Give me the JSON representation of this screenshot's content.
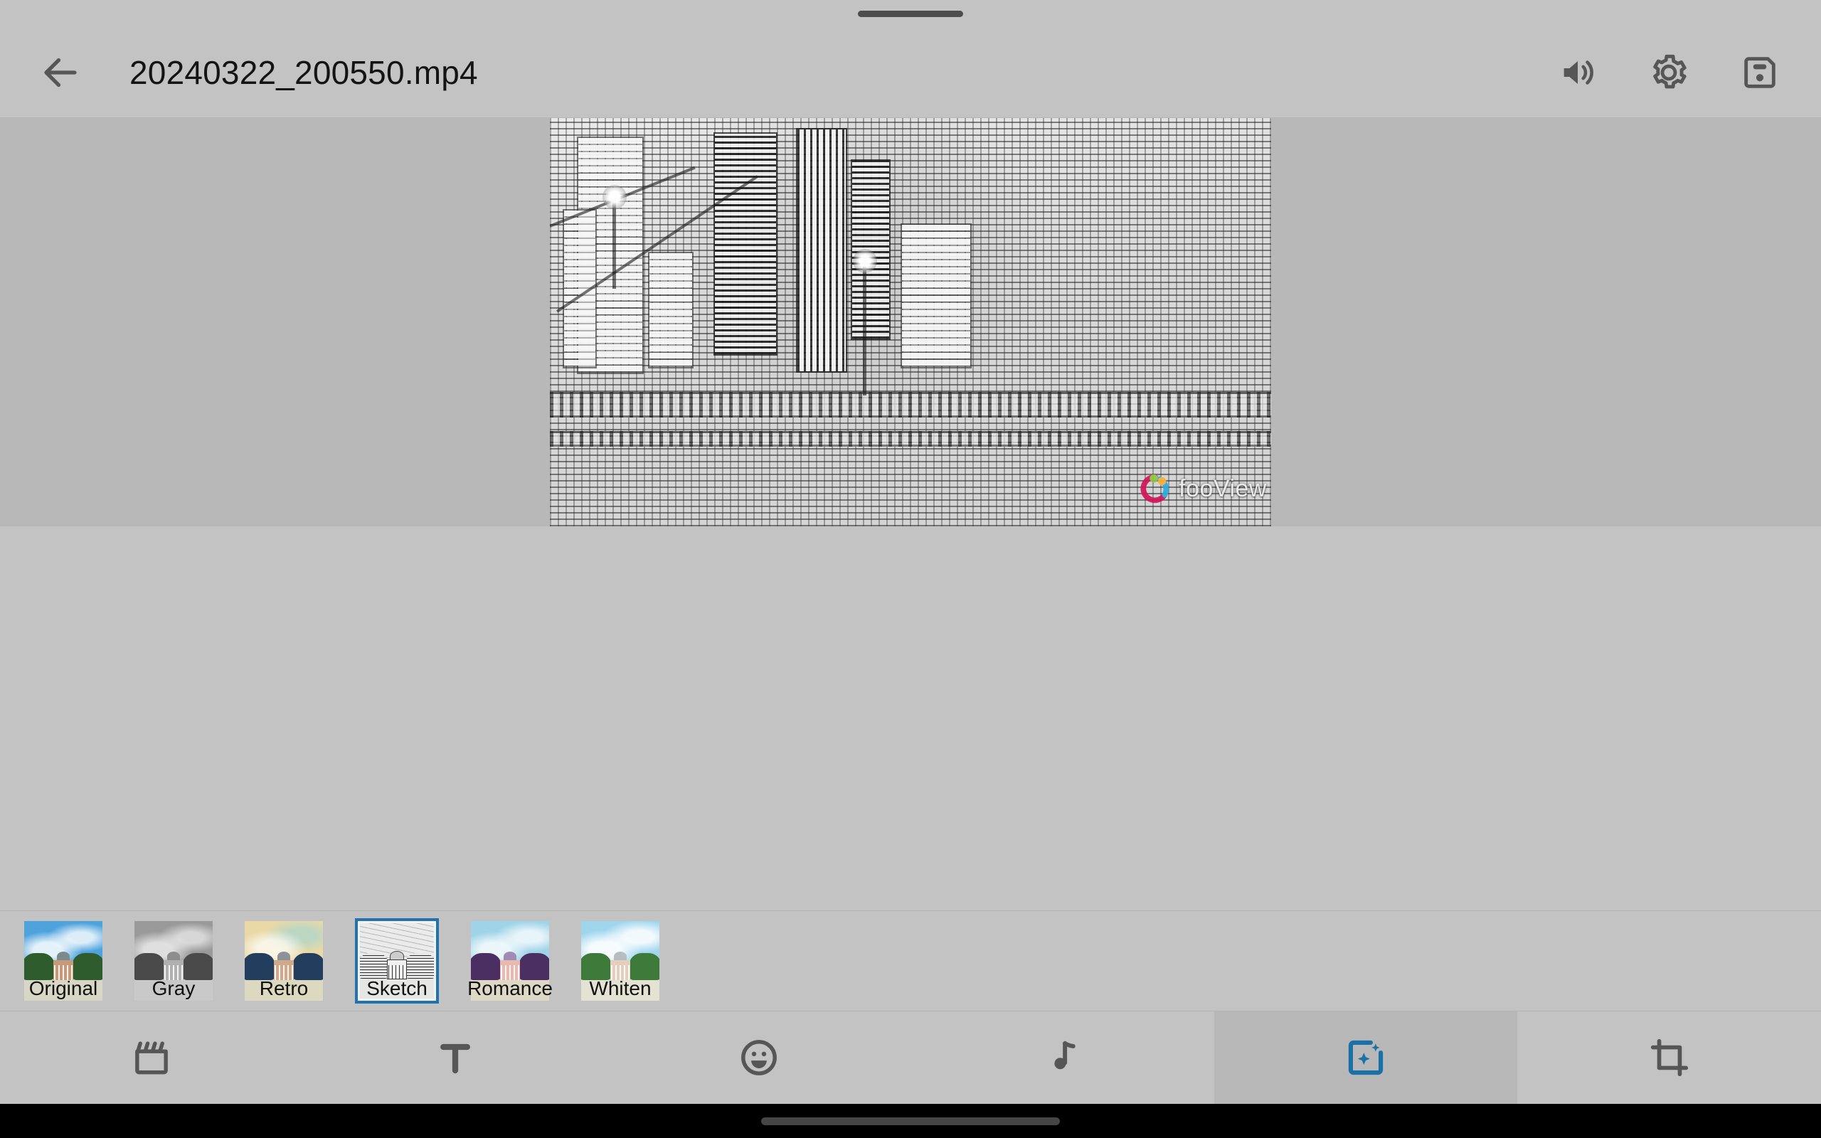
{
  "window": {
    "drag_handle": "drag-handle",
    "background_color": "#c3c3c3"
  },
  "header": {
    "back_icon": "arrow-left-icon",
    "title": "20240322_200550.mp4",
    "actions": [
      {
        "name": "volume-button",
        "icon": "volume-up-icon",
        "label": "Volume"
      },
      {
        "name": "settings-button",
        "icon": "gear-icon",
        "label": "Settings"
      },
      {
        "name": "save-button",
        "icon": "floppy-disk-save-icon",
        "label": "Save"
      }
    ]
  },
  "preview": {
    "name": "video-preview",
    "applied_filter": "Sketch",
    "watermark_text": "fooView",
    "watermark_logo": "fooview-logo-icon",
    "canvas_color": "#b8b8b8"
  },
  "side_handle": {
    "name": "edge-pill-handle"
  },
  "filters": {
    "selected": "Sketch",
    "selected_border_color": "#2172ae",
    "items": [
      {
        "label": "Original",
        "sky": "#4ea3dd",
        "ground": "#d8d6c4",
        "tree": "#2f5c2c",
        "bldg_body": "#c49a7b",
        "dome": "#7d8a8c"
      },
      {
        "label": "Gray",
        "sky": "#9a9a9a",
        "ground": "#c9c9c9",
        "tree": "#4a4a4a",
        "bldg_body": "#b0b0b0",
        "dome": "#8d8d8d"
      },
      {
        "label": "Retro",
        "sky": "#ead9a6",
        "ground": "#dcd9c0",
        "tree": "#223d5e",
        "bldg_body": "#cfa98c",
        "dome": "#8d9298"
      },
      {
        "label": "Sketch",
        "sky": "#ebebeb",
        "ground": "#e6e6e4",
        "tree": "#3a3a3a",
        "bldg_body": "#f0f0f0",
        "dome": "#cccccc"
      },
      {
        "label": "Romance",
        "sky": "#9fd4e8",
        "ground": "#ded8c6",
        "tree": "#4b2f63",
        "bldg_body": "#e8b9b0",
        "dome": "#a08bb5"
      },
      {
        "label": "Whiten",
        "sky": "#9fd6ee",
        "ground": "#e4e2d2",
        "tree": "#3e7a3a",
        "bldg_body": "#e3cfc0",
        "dome": "#b7bec0"
      }
    ]
  },
  "toolbar": {
    "active": "Filters",
    "active_color": "#1971a8",
    "tabs": [
      {
        "label": "Clip",
        "icon": "clapperboard-icon",
        "active": false
      },
      {
        "label": "Text",
        "icon": "text-t-icon",
        "active": false
      },
      {
        "label": "Sticker",
        "icon": "emoji-face-icon",
        "active": false
      },
      {
        "label": "Music",
        "icon": "music-note-icon",
        "active": false
      },
      {
        "label": "Filters",
        "icon": "magic-sparkle-frame-icon",
        "active": true
      },
      {
        "label": "Crop",
        "icon": "crop-icon",
        "active": false
      }
    ]
  },
  "system_nav": {
    "home_indicator": "home-indicator"
  }
}
